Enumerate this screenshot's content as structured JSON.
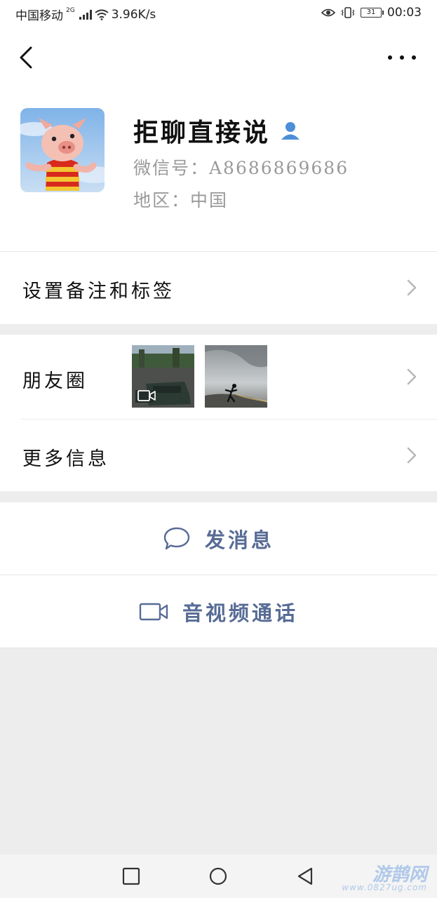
{
  "status_bar": {
    "carrier": "中国移动",
    "network_gen": "2G",
    "speed": "3.96K/s",
    "battery": "31",
    "time": "00:03",
    "icons": [
      "signal-icon",
      "wifi-icon",
      "eye-icon",
      "vibrate-icon",
      "battery-icon"
    ]
  },
  "header": {
    "back_icon": "back-chevron-icon",
    "more_icon": "more-dots-icon"
  },
  "profile": {
    "name": "拒聊直接说",
    "wechat_id": "微信号：A8686869686",
    "region": "地区：中国",
    "badge_icon": "contact-person-icon"
  },
  "rows": {
    "remarks_label": "设置备注和标签",
    "moments_label": "朋友圈",
    "more_info_label": "更多信息"
  },
  "actions": {
    "message_label": "发消息",
    "video_call_label": "音视频通话"
  },
  "watermark": {
    "text": "游鹊网",
    "url": "www.0827ug.com"
  },
  "colors": {
    "accent": "#576b95",
    "background": "#ededed",
    "secondary_text": "#9a9a9a"
  }
}
